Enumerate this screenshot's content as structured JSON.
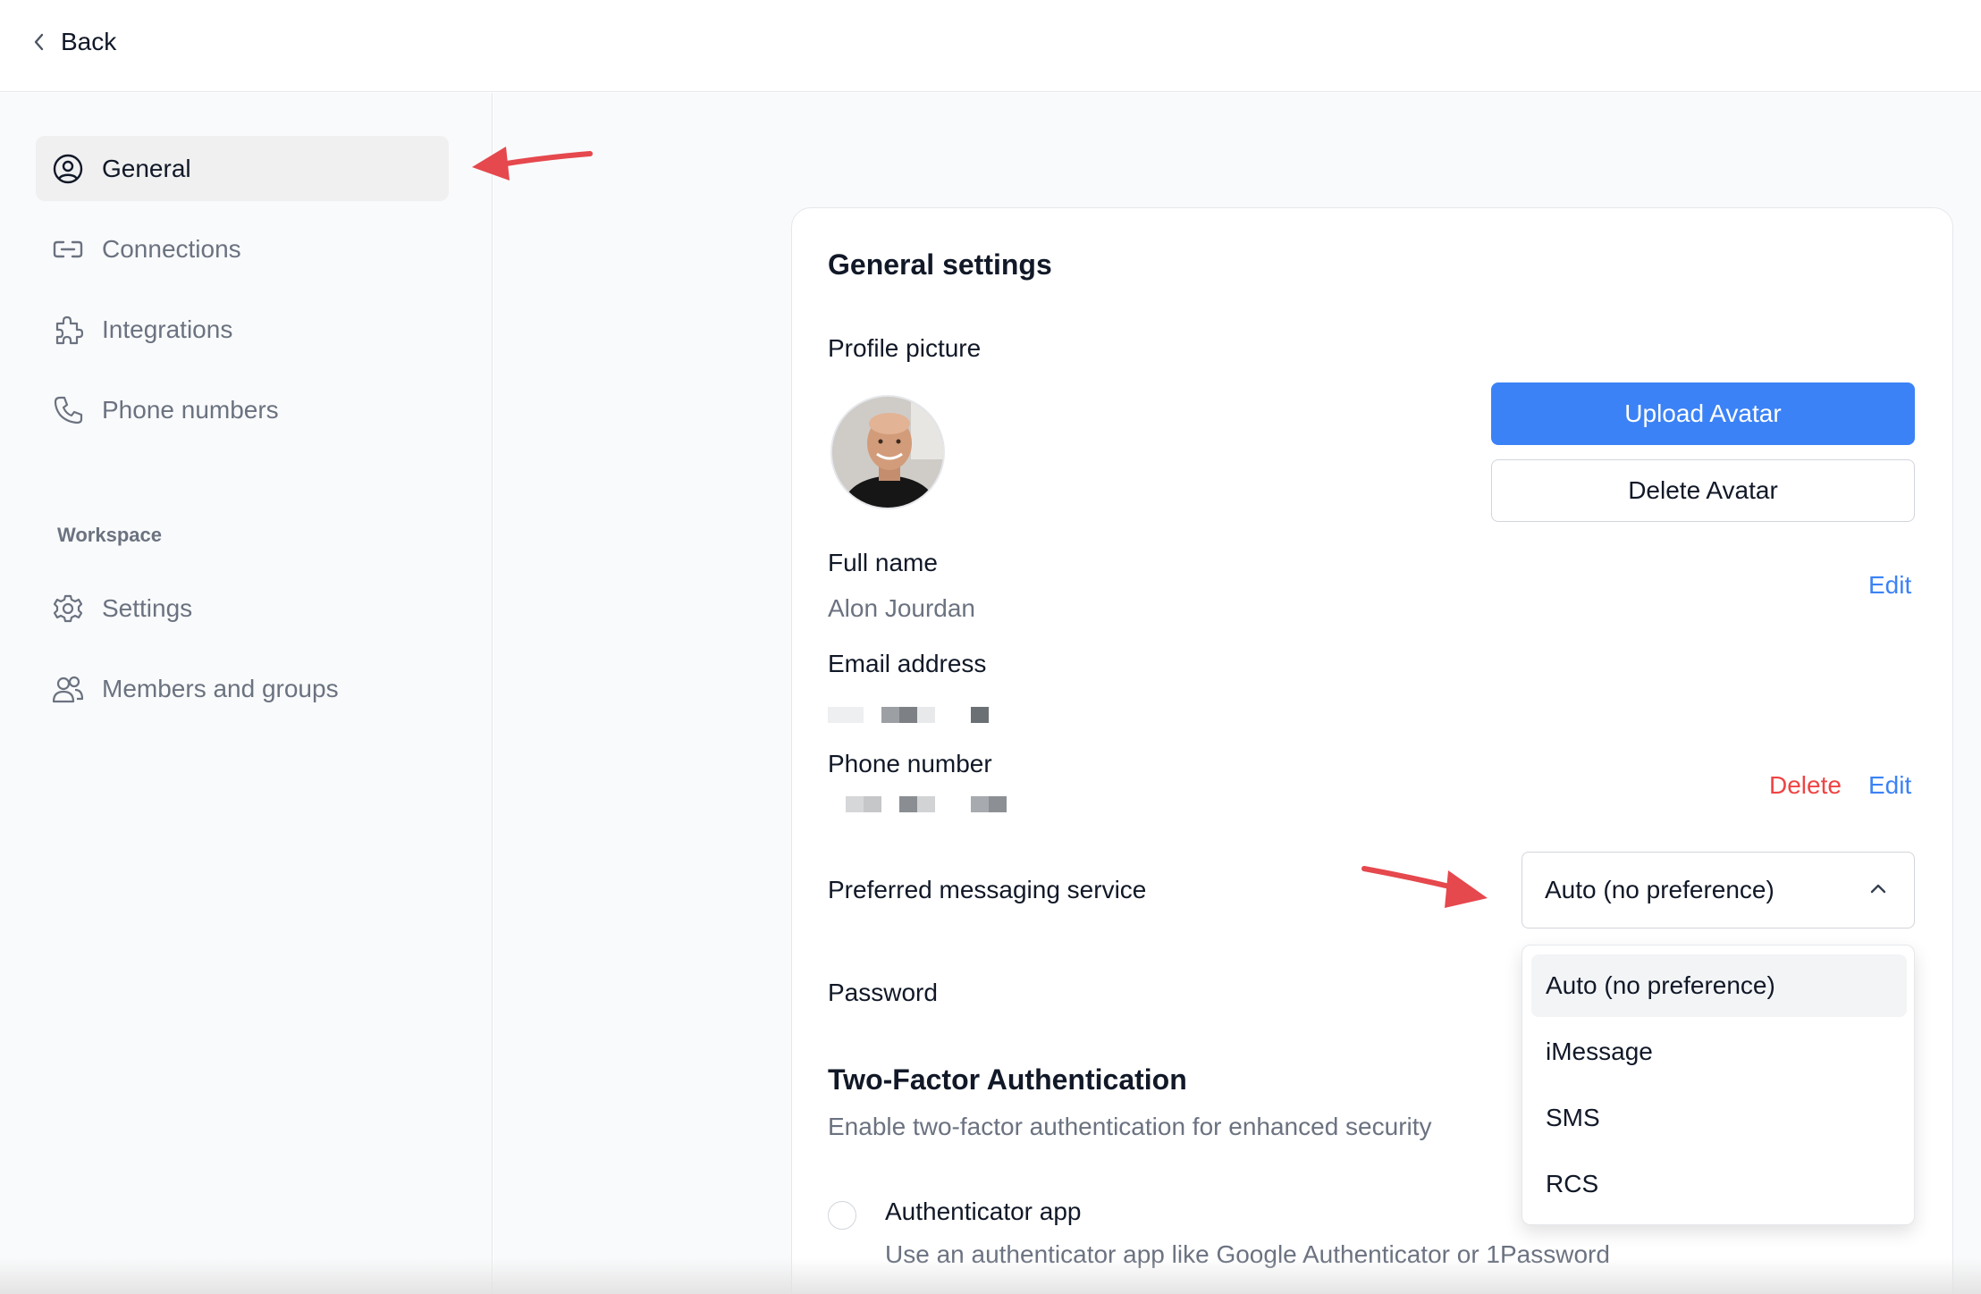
{
  "header": {
    "back_label": "Back"
  },
  "sidebar": {
    "items": [
      {
        "label": "General",
        "icon": "user-circle-icon",
        "active": true
      },
      {
        "label": "Connections",
        "icon": "link-icon"
      },
      {
        "label": "Integrations",
        "icon": "puzzle-icon"
      },
      {
        "label": "Phone numbers",
        "icon": "phone-icon"
      }
    ],
    "workspace_label": "Workspace",
    "workspace_items": [
      {
        "label": "Settings",
        "icon": "gear-icon"
      },
      {
        "label": "Members and groups",
        "icon": "users-icon"
      }
    ]
  },
  "settings": {
    "title": "General settings",
    "profile_picture_label": "Profile picture",
    "upload_avatar": "Upload Avatar",
    "delete_avatar": "Delete Avatar",
    "full_name_label": "Full name",
    "full_name_value": "Alon Jourdan",
    "edit": "Edit",
    "email_label": "Email address",
    "phone_label": "Phone number",
    "delete": "Delete",
    "messaging_label": "Preferred messaging service",
    "messaging_selected": "Auto (no preference)",
    "messaging_options": [
      "Auto (no preference)",
      "iMessage",
      "SMS",
      "RCS"
    ],
    "password_label": "Password",
    "twofa_title": "Two-Factor Authentication",
    "twofa_desc": "Enable two-factor authentication for enhanced security",
    "authenticator_title": "Authenticator app",
    "authenticator_desc": "Use an authenticator app like Google Authenticator or 1Password"
  },
  "colors": {
    "accent": "#3b82f6",
    "danger": "#ef4444",
    "annotation_arrow": "#e5484d"
  }
}
